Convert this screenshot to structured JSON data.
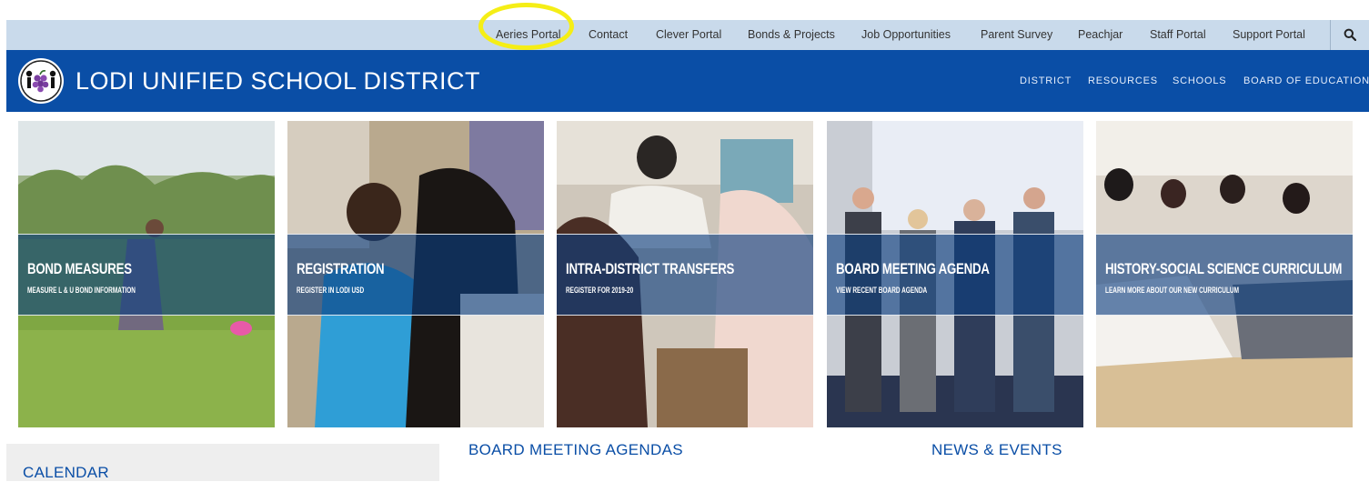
{
  "utility_nav": {
    "links": [
      "Aeries Portal",
      "Contact",
      "Clever Portal",
      "Bonds & Projects",
      "Job Opportunities",
      "Parent Survey",
      "Peachjar",
      "Staff Portal",
      "Support Portal"
    ],
    "search_icon": "search-icon",
    "highlight_color": "#f5ee16"
  },
  "header": {
    "title": "LODI UNIFIED SCHOOL DISTRICT",
    "logo_icon": "district-logo-icon",
    "nav": [
      "DISTRICT",
      "RESOURCES",
      "SCHOOLS",
      "BOARD OF EDUCATION"
    ]
  },
  "tiles": [
    {
      "title": "BOND MEASURES",
      "subtitle": "MEASURE L & U BOND INFORMATION"
    },
    {
      "title": "REGISTRATION",
      "subtitle": "REGISTER IN LODI USD"
    },
    {
      "title": "INTRA-DISTRICT TRANSFERS",
      "subtitle": "REGISTER FOR 2019-20"
    },
    {
      "title": "BOARD MEETING AGENDA",
      "subtitle": "VIEW RECENT BOARD AGENDA"
    },
    {
      "title": "HISTORY-SOCIAL SCIENCE CURRICULUM",
      "subtitle": "LEARN MORE ABOUT OUR NEW CURRICULUM"
    }
  ],
  "sections": {
    "calendar": "CALENDAR",
    "board_agendas": "BOARD MEETING AGENDAS",
    "news": "NEWS & EVENTS"
  },
  "colors": {
    "utility_bar": "#c9daeb",
    "header": "#0a4ea6",
    "heading_text": "#0a4ea6"
  }
}
